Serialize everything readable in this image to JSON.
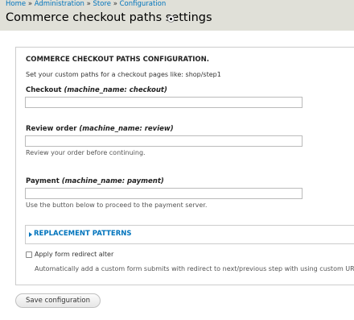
{
  "breadcrumb": {
    "items": [
      "Home",
      "Administration",
      "Store",
      "Configuration"
    ],
    "separator": "»"
  },
  "page": {
    "title": "Commerce checkout paths settings"
  },
  "form": {
    "legend": "COMMERCE CHECKOUT PATHS CONFIGURATION.",
    "intro": "Set your custom paths for a checkout pages like: shop/step1",
    "fields": [
      {
        "label": "Checkout",
        "machine": "(machine_name: checkout)",
        "value": "",
        "description": ""
      },
      {
        "label": "Review order",
        "machine": "(machine_name: review)",
        "value": "",
        "description": "Review your order before continuing."
      },
      {
        "label": "Payment",
        "machine": "(machine_name: payment)",
        "value": "",
        "description": "Use the button below to proceed to the payment server."
      }
    ],
    "replacement_patterns": "REPLACEMENT PATTERNS",
    "checkbox": {
      "label": "Apply form redirect alter",
      "checked": false,
      "description": "Automatically add a custom form submits with redirect to next/previous step with using custom URLs."
    },
    "save_label": "Save configuration"
  },
  "colors": {
    "link": "#0074bd",
    "header_bg": "#e0e0d8"
  }
}
